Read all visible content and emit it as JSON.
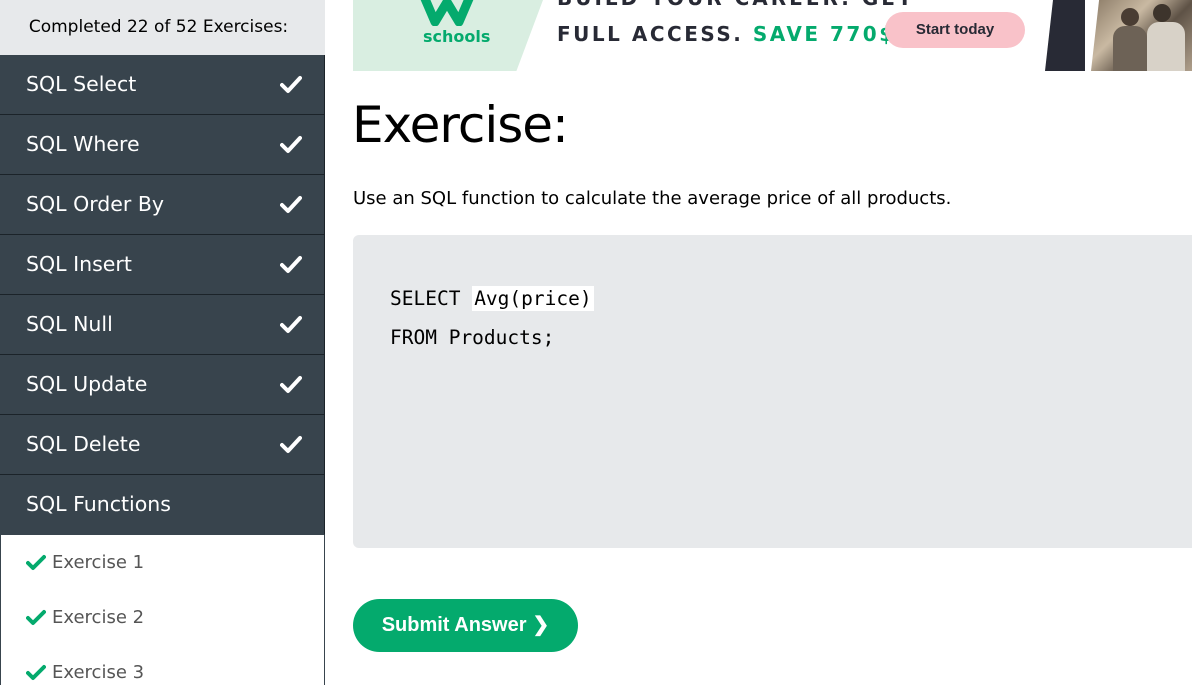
{
  "sidebar": {
    "progress_text": "Completed 22 of 52 Exercises:",
    "categories": [
      {
        "label": "SQL Select",
        "completed": true
      },
      {
        "label": "SQL Where",
        "completed": true
      },
      {
        "label": "SQL Order By",
        "completed": true
      },
      {
        "label": "SQL Insert",
        "completed": true
      },
      {
        "label": "SQL Null",
        "completed": true
      },
      {
        "label": "SQL Update",
        "completed": true
      },
      {
        "label": "SQL Delete",
        "completed": true
      },
      {
        "label": "SQL Functions",
        "completed": false
      }
    ],
    "exercises": [
      {
        "label": "Exercise 1",
        "completed": true
      },
      {
        "label": "Exercise 2",
        "completed": true
      },
      {
        "label": "Exercise 3",
        "completed": true
      }
    ]
  },
  "banner": {
    "logo_text": "schools",
    "headline_top": "BUILD YOUR CAREER. GET",
    "headline_main": "FULL ACCESS.",
    "headline_save": "SAVE 770$",
    "cta_label": "Start today"
  },
  "main": {
    "title": "Exercise:",
    "description": "Use an SQL function to calculate the average price of all products.",
    "code_line1_prefix": "SELECT ",
    "answer_value": "Avg(price)",
    "code_line2": "FROM Products;",
    "submit_label": "Submit Answer",
    "submit_chevron": "❯"
  },
  "colors": {
    "accent_green": "#04aa6d",
    "sidebar_dark": "#38444d",
    "code_bg": "#e7e9eb",
    "cta_pink": "#f9c2c9"
  },
  "icons": {
    "category_check": "check-icon",
    "exercise_check": "green-check-icon"
  }
}
